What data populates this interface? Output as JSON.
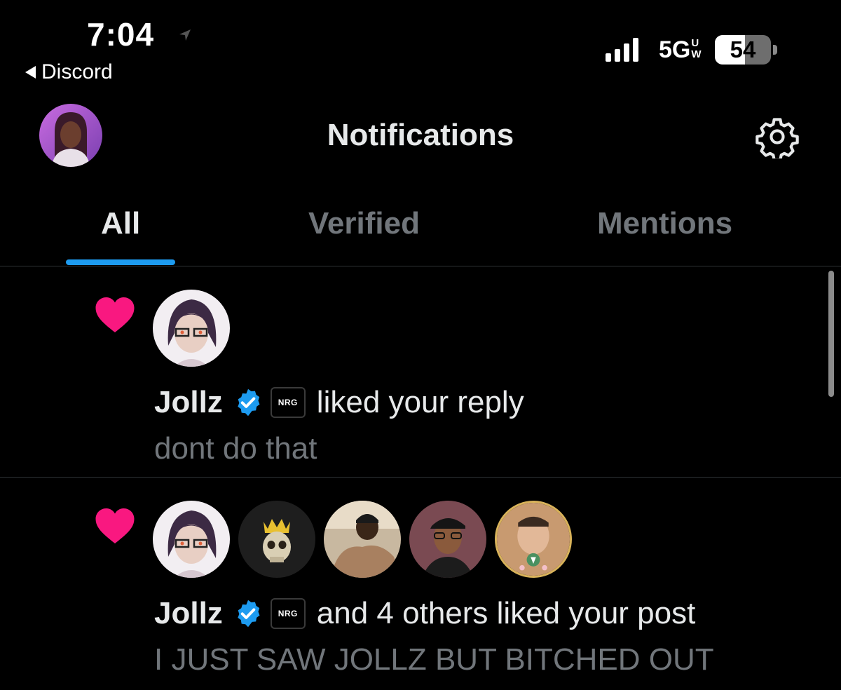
{
  "status_bar": {
    "time": "7:04",
    "back_label": "Discord",
    "network": "5G",
    "network_sup": "U",
    "network_sub": "W",
    "battery": "54",
    "battery_level": 0.54
  },
  "header": {
    "title": "Notifications"
  },
  "tabs": [
    {
      "label": "All",
      "active": true
    },
    {
      "label": "Verified",
      "active": false
    },
    {
      "label": "Mentions",
      "active": false
    }
  ],
  "notifications": [
    {
      "type": "like",
      "name": "Jollz",
      "badge": "NRG",
      "action": "liked your reply",
      "snippet": "dont do that",
      "avatars": [
        "anime-avatar"
      ]
    },
    {
      "type": "like",
      "name": "Jollz",
      "badge": "NRG",
      "action": "and 4 others liked your post",
      "snippet": "I JUST SAW JOLLZ BUT BITCHED OUT",
      "avatars": [
        "anime-avatar",
        "skull-crown-avatar",
        "user-photo-avatar",
        "user-photo-avatar",
        "user-photo-avatar"
      ]
    }
  ],
  "colors": {
    "background": "#000000",
    "accent": "#1d9bf0",
    "heart": "#f91880",
    "muted_text": "#71767b"
  }
}
